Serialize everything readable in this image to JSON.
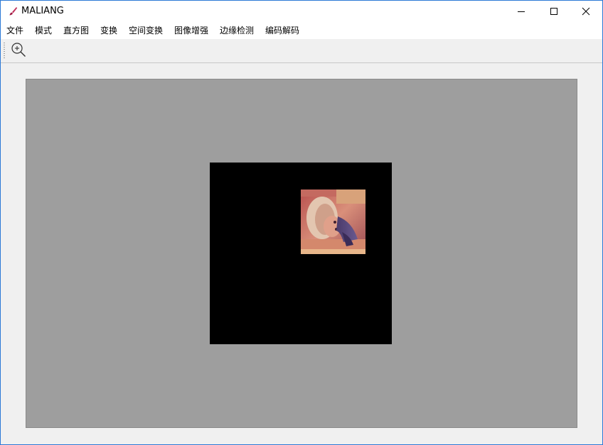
{
  "window": {
    "title": "MALIANG",
    "app_icon": "brush-icon",
    "controls": {
      "minimize": "minimize-icon",
      "maximize": "maximize-icon",
      "close": "close-icon"
    }
  },
  "menu": {
    "items": [
      {
        "label": "文件"
      },
      {
        "label": "模式"
      },
      {
        "label": "直方图"
      },
      {
        "label": "变换"
      },
      {
        "label": "空间变换"
      },
      {
        "label": "图像增强"
      },
      {
        "label": "边缘检测"
      },
      {
        "label": "编码解码"
      }
    ]
  },
  "toolbar": {
    "zoom_icon": "zoom-in-icon"
  },
  "colors": {
    "window_border": "#2b79d6",
    "canvas_bg": "#9e9e9e",
    "image_frame": "#000000"
  }
}
